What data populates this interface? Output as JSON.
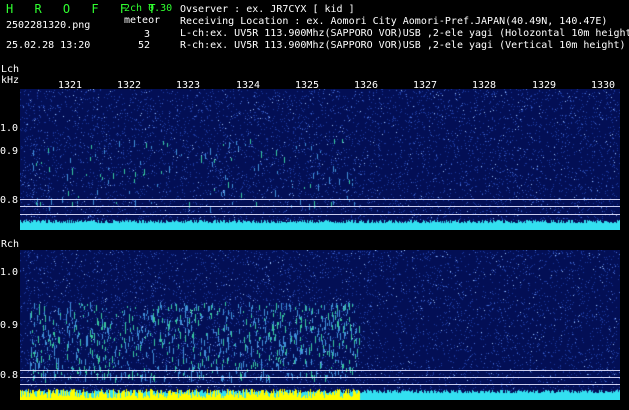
{
  "header": {
    "app_title": "H R O F F T",
    "file_name": "2502281320.png",
    "timestamp": "25.02.28 13:20",
    "mode": "2ch 0.30",
    "meteor_label": "meteor",
    "meteor_count_l": "3",
    "meteor_count_r": "52",
    "info": [
      "Ovserver            : ex. JR7CYX [ kid ]",
      "Receiving Location : ex. Aomori City Aomori-Pref.JAPAN(40.49N, 140.47E)",
      "L-ch:ex. UV5R 113.900Mhz(SAPPORO VOR)USB ,2-ele yagi (Holozontal 10m height",
      "R-ch:ex. UV5R 113.900Mhz(SAPPORO VOR)USB ,2-ele yagi (Vertical 10m height)"
    ]
  },
  "lch": {
    "label": "Lch",
    "unit": "kHz",
    "ticks": [
      "1.0",
      "0.9",
      "0.8"
    ]
  },
  "rch": {
    "label": "Rch",
    "ticks": [
      "1.0",
      "0.9",
      "0.8"
    ]
  },
  "minutes": [
    "1321",
    "1322",
    "1323",
    "1324",
    "1325",
    "1326",
    "1327",
    "1328",
    "1329",
    "1330"
  ],
  "colors": {
    "background": "#000000",
    "noise_floor": "#030f55",
    "carrier": "#33e0f0",
    "meteor_echo": "#ffff00",
    "title": "#30ff30"
  }
}
